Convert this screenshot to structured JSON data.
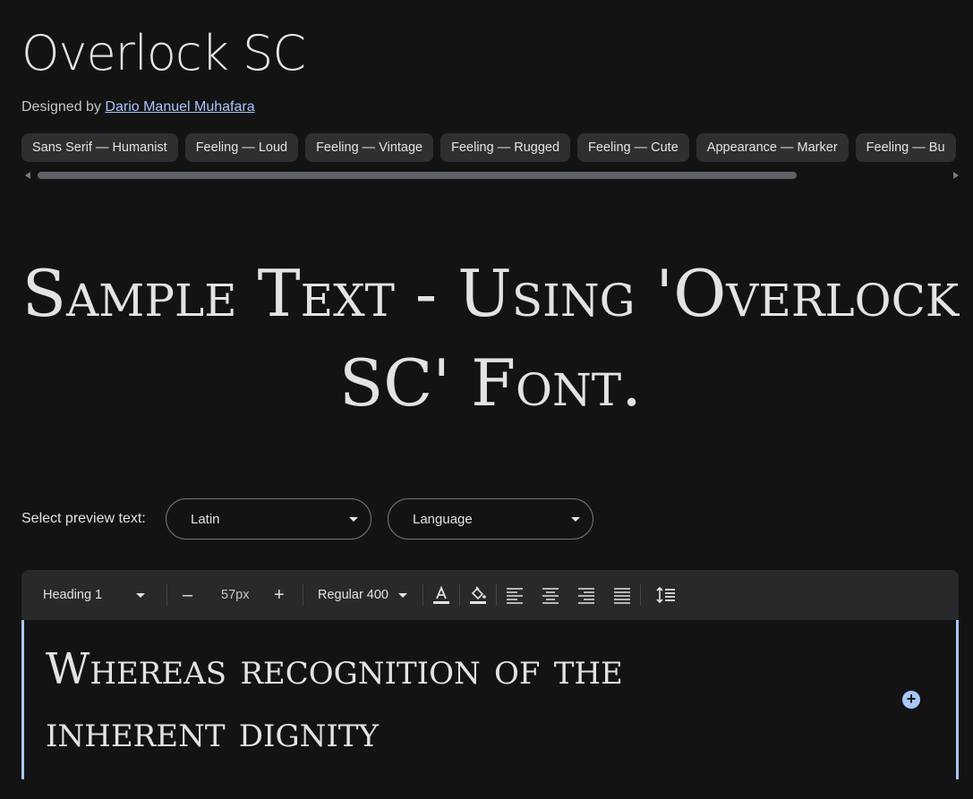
{
  "font": {
    "name": "Overlock SC",
    "designed_by_label": "Designed by",
    "designer": "Dario Manuel Muhafara"
  },
  "tags": [
    "Sans Serif — Humanist",
    "Feeling — Loud",
    "Feeling — Vintage",
    "Feeling — Rugged",
    "Feeling — Cute",
    "Appearance — Marker",
    "Feeling — Bu"
  ],
  "sample_text": "Sample Text - Using 'Overlock SC' Font.",
  "preview": {
    "label": "Select preview text:",
    "script_select": "Latin",
    "language_select": "Language"
  },
  "toolbar": {
    "style_select": "Heading 1",
    "decrease": "–",
    "size": "57px",
    "increase": "+",
    "weight_select": "Regular 400"
  },
  "editor": {
    "text": "Whereas recognition of the inherent dignity",
    "add_icon": "+"
  },
  "colors": {
    "background": "#131314",
    "text": "#e3e3e3",
    "chip": "#2d2f31",
    "accent": "#a8c7fa",
    "toolbar": "#28292a"
  },
  "icons": {
    "text_color": "text-color-icon",
    "highlight": "highlight-fill-icon",
    "align_left": "align-left-icon",
    "align_center": "align-center-icon",
    "align_right": "align-right-icon",
    "align_justify": "align-justify-icon",
    "line_height": "line-height-icon",
    "add": "add-circle-icon"
  }
}
